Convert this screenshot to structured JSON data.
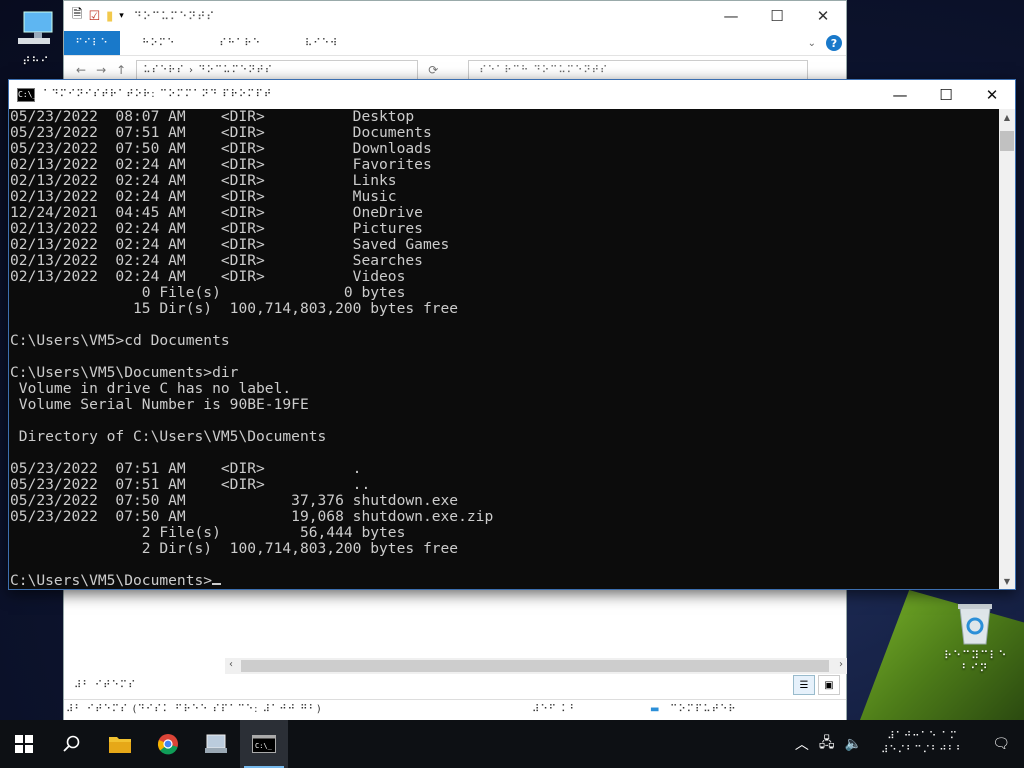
{
  "desktop": {
    "icons": [
      {
        "name": "this-pc",
        "label": "⠞⠓⠊"
      },
      {
        "name": "recycle-bin",
        "label": "⠗⠑⠉⠽⠉⠇⠑"
      }
    ],
    "recycle_label_2": "⠃⠊⠝"
  },
  "explorer": {
    "title": "⠙⠕⠉⠥⠍⠑⠝⠞⠎",
    "ribbon": {
      "file": "⠋⠊⠇⠑",
      "tabs": [
        "⠓⠕⠍⠑",
        "⠎⠓⠁⠗⠑",
        "⠧⠊⠑⠺"
      ]
    },
    "address": "⠥⠎⠑⠗⠎ › ⠙⠕⠉⠥⠍⠑⠝⠞⠎",
    "search_placeholder": "⠎⠑⠁⠗⠉⠓ ⠙⠕⠉⠥⠍⠑⠝⠞⠎",
    "items_count": "⠼⠃ ⠊⠞⠑⠍⠎",
    "status_left": "⠼⠃ ⠊⠞⠑⠍⠎ (⠙⠊⠎⠅ ⠋⠗⠑⠑ ⠎⠏⠁⠉⠑: ⠼⠁⠚⠚ ⠛⠃)",
    "status_mid": "⠼⠑⠋ ⠅⠃",
    "status_right": "⠉⠕⠍⠏⠥⠞⠑⠗"
  },
  "cmd": {
    "title": "⠁⠙⠍⠊⠝⠊⠎⠞⠗⠁⠞⠕⠗: ⠉⠕⠍⠍⠁⠝⠙ ⠏⠗⠕⠍⠏⠞",
    "icon_text": "C:\\_",
    "lines": [
      "05/23/2022  08:07 AM    <DIR>          Desktop",
      "05/23/2022  07:51 AM    <DIR>          Documents",
      "05/23/2022  07:50 AM    <DIR>          Downloads",
      "02/13/2022  02:24 AM    <DIR>          Favorites",
      "02/13/2022  02:24 AM    <DIR>          Links",
      "02/13/2022  02:24 AM    <DIR>          Music",
      "12/24/2021  04:45 AM    <DIR>          OneDrive",
      "02/13/2022  02:24 AM    <DIR>          Pictures",
      "02/13/2022  02:24 AM    <DIR>          Saved Games",
      "02/13/2022  02:24 AM    <DIR>          Searches",
      "02/13/2022  02:24 AM    <DIR>          Videos",
      "               0 File(s)              0 bytes",
      "              15 Dir(s)  100,714,803,200 bytes free",
      "",
      "C:\\Users\\VM5>cd Documents",
      "",
      "C:\\Users\\VM5\\Documents>dir",
      " Volume in drive C has no label.",
      " Volume Serial Number is 90BE-19FE",
      "",
      " Directory of C:\\Users\\VM5\\Documents",
      "",
      "05/23/2022  07:51 AM    <DIR>          .",
      "05/23/2022  07:51 AM    <DIR>          ..",
      "05/23/2022  07:50 AM            37,376 shutdown.exe",
      "05/23/2022  07:50 AM            19,068 shutdown.exe.zip",
      "               2 File(s)         56,444 bytes",
      "               2 Dir(s)  100,714,803,200 bytes free",
      ""
    ],
    "prompt": "C:\\Users\\VM5\\Documents>"
  },
  "taskbar": {
    "clock_time": "⠼⠁⠚⠒⠁⠑ ⠁⠍",
    "clock_date": "⠼⠑⠌⠃⠉⠌⠃⠚⠃⠃"
  },
  "colors": {
    "accent": "#1979ca",
    "console_bg": "#0c0c0c",
    "console_fg": "#cccccc",
    "taskbar": "#0d1014"
  }
}
